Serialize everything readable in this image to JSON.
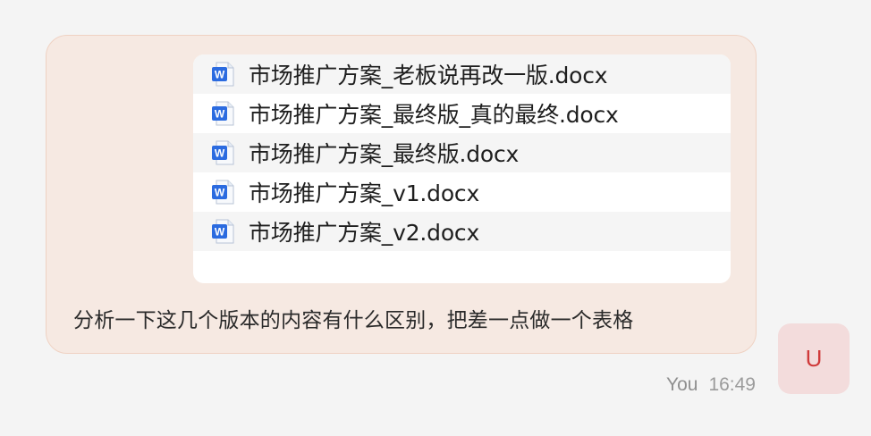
{
  "message": {
    "attachments": [
      {
        "name": "市场推广方案_老板说再改一版.docx",
        "icon": "word-doc-icon"
      },
      {
        "name": "市场推广方案_最终版_真的最终.docx",
        "icon": "word-doc-icon"
      },
      {
        "name": "市场推广方案_最终版.docx",
        "icon": "word-doc-icon"
      },
      {
        "name": "市场推广方案_v1.docx",
        "icon": "word-doc-icon"
      },
      {
        "name": "市场推广方案_v2.docx",
        "icon": "word-doc-icon"
      }
    ],
    "text": "分析一下这几个版本的内容有什么区别，把差一点做一个表格",
    "sender": "You",
    "time": "16:49"
  },
  "avatar": {
    "letter": "U"
  },
  "colors": {
    "bubble_bg": "#f6e9e2",
    "bubble_border": "#efd2c3",
    "avatar_bg": "#f3dcdc",
    "avatar_text": "#d03a3a",
    "word_blue": "#2b6be0"
  }
}
